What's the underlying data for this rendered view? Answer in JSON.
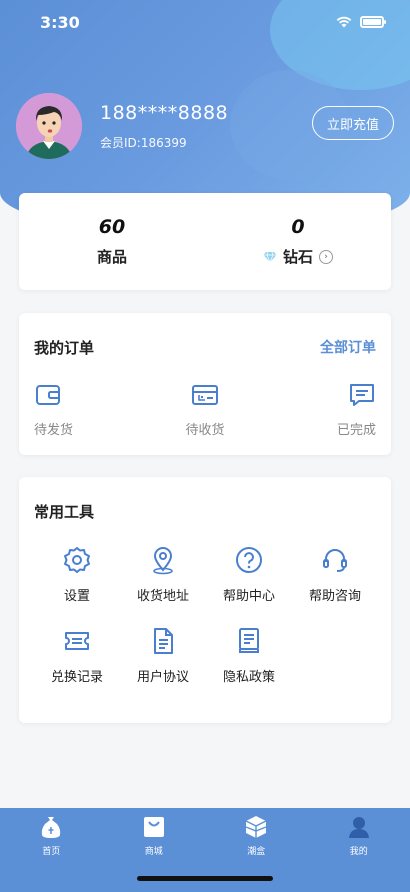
{
  "status_bar": {
    "time": "3:30"
  },
  "profile": {
    "phone": "188****8888",
    "member_id": "会员ID:186399",
    "recharge_label": "立即充值"
  },
  "stats": {
    "products_value": "60",
    "products_label": "商品",
    "diamonds_value": "0",
    "diamonds_label": "钻石"
  },
  "orders": {
    "title": "我的订单",
    "all_label": "全部订单",
    "items": [
      {
        "label": "待发货",
        "icon": "wallet-icon"
      },
      {
        "label": "待收货",
        "icon": "delivery-box-icon"
      },
      {
        "label": "已完成",
        "icon": "message-icon"
      }
    ]
  },
  "tools": {
    "title": "常用工具",
    "items": [
      {
        "label": "设置",
        "icon": "gear-icon"
      },
      {
        "label": "收货地址",
        "icon": "location-pin-icon"
      },
      {
        "label": "帮助中心",
        "icon": "question-icon"
      },
      {
        "label": "帮助咨询",
        "icon": "headset-icon"
      },
      {
        "label": "兑换记录",
        "icon": "ticket-icon"
      },
      {
        "label": "用户协议",
        "icon": "document-icon"
      },
      {
        "label": "隐私政策",
        "icon": "book-icon"
      }
    ]
  },
  "tabbar": {
    "items": [
      {
        "label": "首页",
        "icon": "home-bag-icon"
      },
      {
        "label": "商城",
        "icon": "shop-icon"
      },
      {
        "label": "潮盒",
        "icon": "box-icon"
      },
      {
        "label": "我的",
        "icon": "user-icon"
      }
    ]
  },
  "colors": {
    "accent": "#5b8fd6",
    "icon_blue": "#4a7fcf"
  }
}
